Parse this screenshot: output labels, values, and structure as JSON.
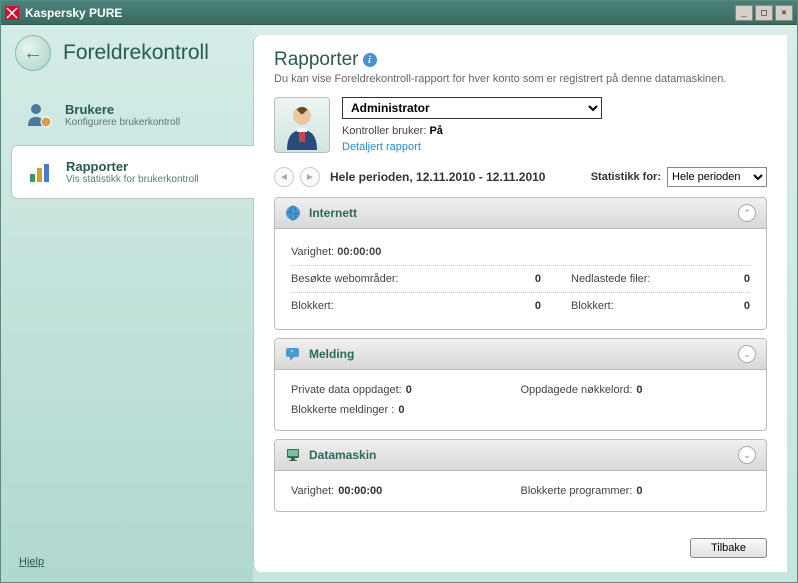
{
  "window": {
    "title": "Kaspersky PURE"
  },
  "sidebar": {
    "section_title": "Foreldrekontroll",
    "items": [
      {
        "title": "Brukere",
        "subtitle": "Konfigurere brukerkontroll"
      },
      {
        "title": "Rapporter",
        "subtitle": "Vis statistikk for brukerkontroll"
      }
    ],
    "help": "Hjelp"
  },
  "main": {
    "title": "Rapporter",
    "description": "Du kan vise Foreldrekontroll-rapport for hver konto som er registrert på denne datamaskinen.",
    "user": {
      "selected": "Administrator",
      "status_label": "Kontroller bruker:",
      "status_value": "På",
      "detail_link": "Detaljert rapport"
    },
    "period": {
      "text": "Hele perioden, 12.11.2010 - 12.11.2010",
      "stat_label": "Statistikk for:",
      "selected": "Hele perioden"
    },
    "sections": {
      "internet": {
        "title": "Internett",
        "duration_label": "Varighet:",
        "duration_value": "00:00:00",
        "visited_label": "Besøkte webområder:",
        "visited_value": "0",
        "downloads_label": "Nedlastede filer:",
        "downloads_value": "0",
        "blocked_label": "Blokkert:",
        "blocked_value1": "0",
        "blocked2_label": "Blokkert:",
        "blocked_value2": "0"
      },
      "messaging": {
        "title": "Melding",
        "private_label": "Private data oppdaget:",
        "private_value": "0",
        "keywords_label": "Oppdagede nøkkelord:",
        "keywords_value": "0",
        "blocked_msg_label": "Blokkerte meldinger :",
        "blocked_msg_value": "0"
      },
      "computer": {
        "title": "Datamaskin",
        "duration_label": "Varighet:",
        "duration_value": "00:00:00",
        "blocked_prog_label": "Blokkerte programmer:",
        "blocked_prog_value": "0"
      }
    },
    "back_button": "Tilbake"
  }
}
